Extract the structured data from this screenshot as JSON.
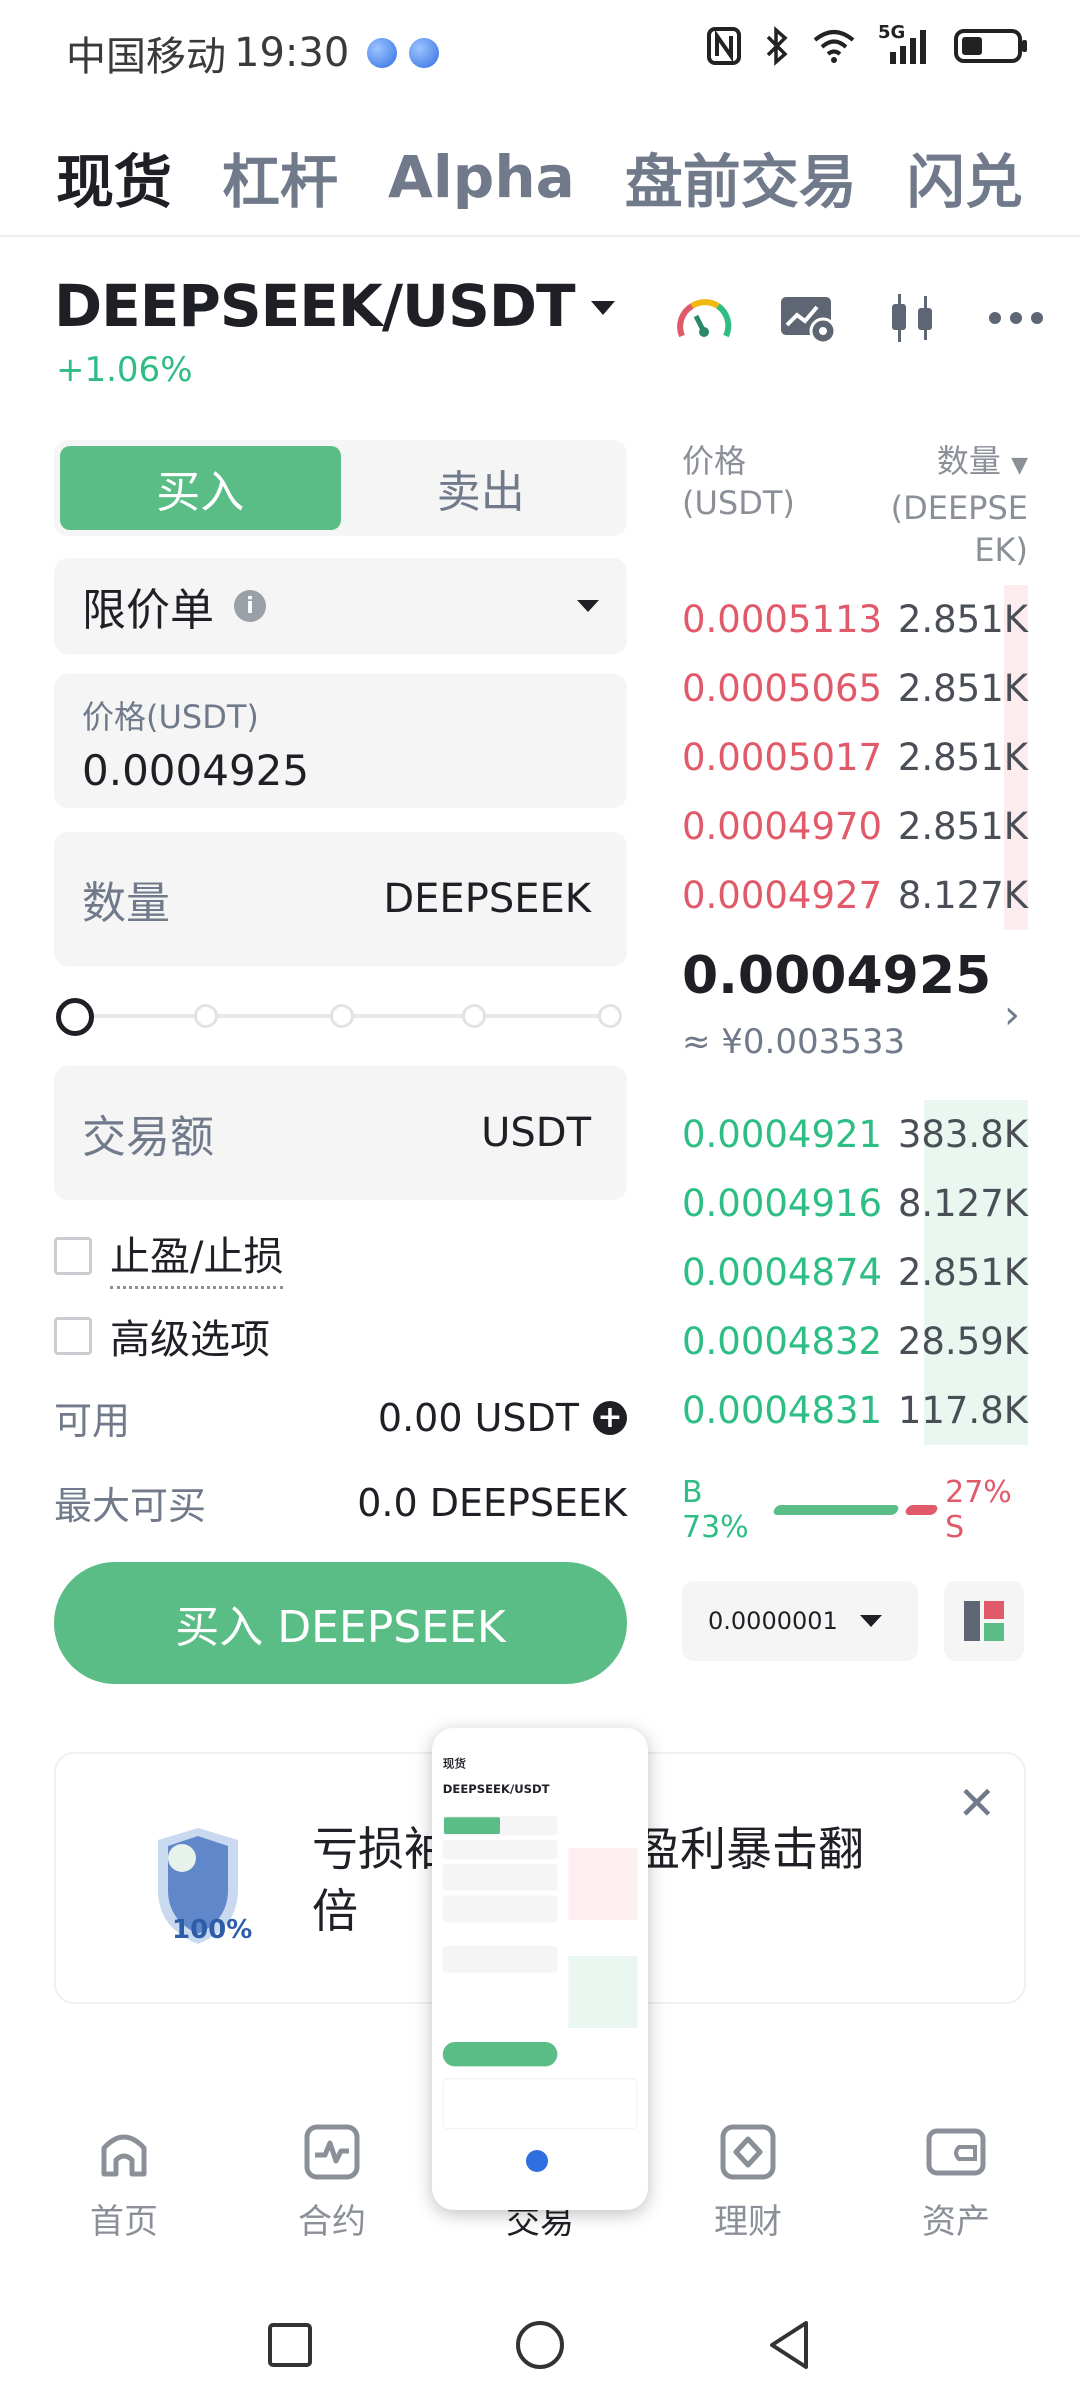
{
  "status_bar": {
    "carrier": "中国移动",
    "time": "19:30",
    "network": "5G"
  },
  "top_tabs": [
    {
      "label": "现货",
      "active": true
    },
    {
      "label": "杠杆"
    },
    {
      "label": "Alpha"
    },
    {
      "label": "盘前交易"
    },
    {
      "label": "闪兑"
    }
  ],
  "pair": {
    "symbol": "DEEPSEEK/USDT",
    "change": "+1.06%"
  },
  "header_icons": [
    "gauge-icon",
    "chart-settings-icon",
    "candlestick-icon",
    "more-icon"
  ],
  "order": {
    "buy_label": "买入",
    "sell_label": "卖出",
    "order_type": "限价单",
    "price_label": "价格(USDT)",
    "price_value": "0.0004925",
    "quantity_placeholder": "数量",
    "quantity_unit": "DEEPSEEK",
    "amount_placeholder": "交易额",
    "amount_unit": "USDT",
    "tp_sl_label": "止盈/止损",
    "advanced_label": "高级选项",
    "available_label": "可用",
    "available_value": "0.00 USDT",
    "max_buy_label": "最大可买",
    "max_buy_value": "0.0 DEEPSEEK",
    "submit_label": "买入 DEEPSEEK"
  },
  "orderbook": {
    "price_header_1": "价格",
    "price_header_2": "(USDT)",
    "qty_header_1": "数量",
    "qty_header_2": "(DEEPSE",
    "qty_header_3": "EK)",
    "asks": [
      {
        "price": "0.0005113",
        "qty": "2.851K",
        "depth": 0.07
      },
      {
        "price": "0.0005065",
        "qty": "2.851K",
        "depth": 0.07
      },
      {
        "price": "0.0005017",
        "qty": "2.851K",
        "depth": 0.07
      },
      {
        "price": "0.0004970",
        "qty": "2.851K",
        "depth": 0.07
      },
      {
        "price": "0.0004927",
        "qty": "8.127K",
        "depth": 0.07
      }
    ],
    "mid_price": "0.0004925",
    "mid_cny": "≈ ¥0.003533",
    "bids": [
      {
        "price": "0.0004921",
        "qty": "383.8K",
        "depth": 0.3
      },
      {
        "price": "0.0004916",
        "qty": "8.127K",
        "depth": 0.3
      },
      {
        "price": "0.0004874",
        "qty": "2.851K",
        "depth": 0.3
      },
      {
        "price": "0.0004832",
        "qty": "28.59K",
        "depth": 0.3
      },
      {
        "price": "0.0004831",
        "qty": "117.8K",
        "depth": 0.3
      }
    ],
    "buy_ratio": "B 73%",
    "sell_ratio": "27% S",
    "precision": "0.0000001"
  },
  "banner": {
    "text": "亏损补偿百分百，盈利暴击翻倍",
    "visible_left": "亏损袖",
    "visible_right": "，盈利暴击翻",
    "visible_line2": "倍",
    "badge": "100%"
  },
  "bottom_nav": [
    {
      "label": "首页"
    },
    {
      "label": "合约"
    },
    {
      "label": "交易",
      "active": true
    },
    {
      "label": "理财"
    },
    {
      "label": "资产"
    }
  ],
  "colors": {
    "green": "#5bbd86",
    "red": "#e05a6a",
    "text": "#1e2026",
    "muted": "#707a8a"
  }
}
